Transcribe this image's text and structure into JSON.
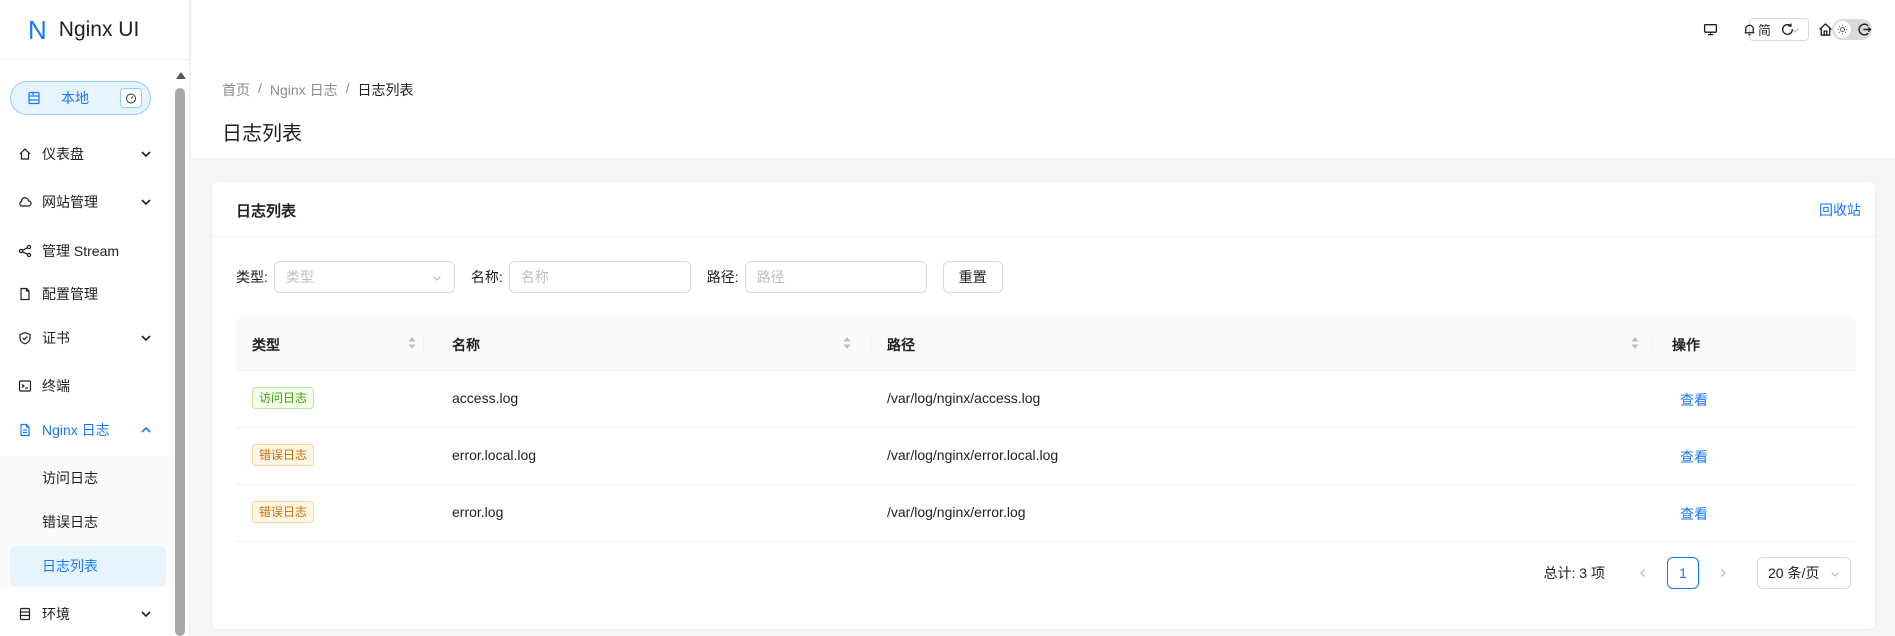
{
  "app": {
    "logo_letter": "N",
    "title": "Nginx UI"
  },
  "node": {
    "label": "本地",
    "icon": "server-icon",
    "dashboard_icon": "dashboard-icon"
  },
  "sidebar": {
    "items": [
      {
        "label": "仪表盘",
        "icon": "home-icon",
        "expandable": true
      },
      {
        "label": "网站管理",
        "icon": "cloud-icon",
        "expandable": true
      },
      {
        "label": "管理 Stream",
        "icon": "share-icon",
        "expandable": false
      },
      {
        "label": "配置管理",
        "icon": "file-icon",
        "expandable": false
      },
      {
        "label": "证书",
        "icon": "shield-icon",
        "expandable": true
      },
      {
        "label": "终端",
        "icon": "terminal-icon",
        "expandable": false
      },
      {
        "label": "Nginx 日志",
        "icon": "file-text-icon",
        "expandable": true,
        "active": true
      },
      {
        "label": "环境",
        "icon": "database-icon",
        "expandable": true
      }
    ],
    "subitems": [
      {
        "label": "访问日志"
      },
      {
        "label": "错误日志"
      },
      {
        "label": "日志列表",
        "selected": true
      }
    ]
  },
  "header": {
    "language": "简",
    "icons": [
      "desktop-icon",
      "bell-icon",
      "reload-icon",
      "home-icon",
      "logout-icon"
    ]
  },
  "breadcrumb": {
    "items": [
      "首页",
      "Nginx 日志",
      "日志列表"
    ],
    "separator": "/"
  },
  "page": {
    "title": "日志列表"
  },
  "card": {
    "title": "日志列表",
    "extra": "回收站"
  },
  "filters": {
    "type_label": "类型:",
    "type_placeholder": "类型",
    "name_label": "名称:",
    "name_placeholder": "名称",
    "path_label": "路径:",
    "path_placeholder": "路径",
    "reset_label": "重置"
  },
  "table": {
    "columns": [
      "类型",
      "名称",
      "路径",
      "操作"
    ],
    "rows": [
      {
        "type": "访问日志",
        "type_color": "green",
        "name": "access.log",
        "path": "/var/log/nginx/access.log",
        "action": "查看"
      },
      {
        "type": "错误日志",
        "type_color": "orange",
        "name": "error.local.log",
        "path": "/var/log/nginx/error.local.log",
        "action": "查看"
      },
      {
        "type": "错误日志",
        "type_color": "orange",
        "name": "error.log",
        "path": "/var/log/nginx/error.log",
        "action": "查看"
      }
    ]
  },
  "pagination": {
    "total": "总计: 3 项",
    "current": "1",
    "page_size": "20 条/页"
  },
  "colors": {
    "primary": "#1677ff",
    "access_tag": "#389e0d",
    "error_tag": "#d46b08"
  }
}
